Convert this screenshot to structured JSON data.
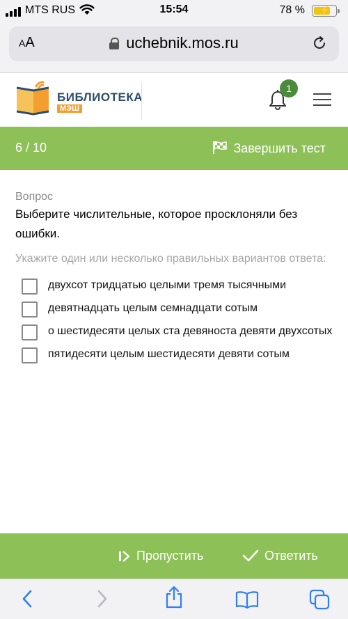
{
  "status_bar": {
    "carrier": "MTS RUS",
    "time": "15:54",
    "battery": "78 %"
  },
  "browser": {
    "text_size": "AA",
    "url": "uchebnik.mos.ru"
  },
  "header": {
    "logo_title": "БИБЛИОТЕКА",
    "logo_subtitle": "МЭШ",
    "notification_count": "1"
  },
  "test_bar": {
    "progress": "6 / 10",
    "finish_label": "Завершить тест"
  },
  "question": {
    "label": "Вопрос",
    "text": "Выберите числительные, которое просклоняли без ошибки.",
    "hint": "Укажите один или несколько правильных вариантов ответа:",
    "options": [
      {
        "label": "двухсот тридцатью целыми тремя тысячными",
        "checked": false
      },
      {
        "label": "девятнадцать целым семнадцати сотым",
        "checked": false
      },
      {
        "label": "о шестидесяти целых ста девяноста девяти двухсотых",
        "checked": false
      },
      {
        "label": "пятидесяти целым шестидесяти девяти сотым",
        "checked": false
      }
    ]
  },
  "actions": {
    "skip_label": "Пропустить",
    "answer_label": "Ответить"
  },
  "colors": {
    "accent_green": "#8dc057",
    "badge_green": "#4a8c3a",
    "logo_orange": "#f29f30",
    "logo_blue": "#2d4d6b",
    "safari_blue": "#2f7ef6"
  }
}
